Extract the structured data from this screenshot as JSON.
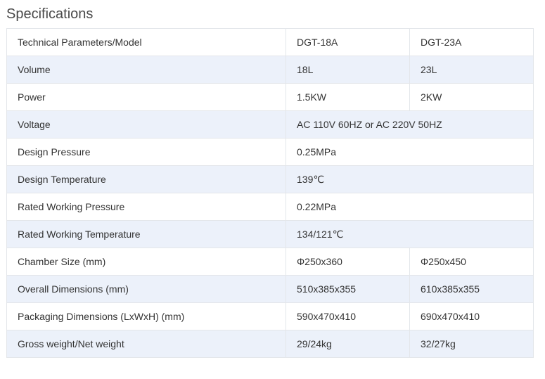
{
  "page": {
    "title": "Specifications"
  },
  "table": {
    "header": [
      "Technical Parameters/Model",
      "DGT-18A",
      "DGT-23A"
    ],
    "rows": [
      {
        "label": "Volume",
        "values": [
          "18L",
          "23L"
        ]
      },
      {
        "label": "Power",
        "values": [
          "1.5KW",
          "2KW"
        ]
      },
      {
        "label": "Voltage",
        "values": [
          "AC 110V 60HZ or AC 220V 50HZ"
        ]
      },
      {
        "label": "Design Pressure",
        "values": [
          "0.25MPa"
        ]
      },
      {
        "label": "Design Temperature",
        "values": [
          "139℃"
        ]
      },
      {
        "label": "Rated Working Pressure",
        "values": [
          "0.22MPa"
        ]
      },
      {
        "label": "Rated Working Temperature",
        "values": [
          "134/121℃"
        ]
      },
      {
        "label": "Chamber Size (mm)",
        "values": [
          "Φ250x360",
          "Φ250x450"
        ]
      },
      {
        "label": "Overall Dimensions (mm)",
        "values": [
          "510x385x355",
          "610x385x355"
        ]
      },
      {
        "label": "Packaging Dimensions (LxWxH) (mm)",
        "values": [
          "590x470x410",
          "690x470x410"
        ]
      },
      {
        "label": "Gross weight/Net weight",
        "values": [
          "29/24kg",
          "32/27kg"
        ]
      }
    ]
  },
  "colors": {
    "stripe": "#ecf1fa",
    "border": "#e3e6ea",
    "text": "#333333"
  }
}
